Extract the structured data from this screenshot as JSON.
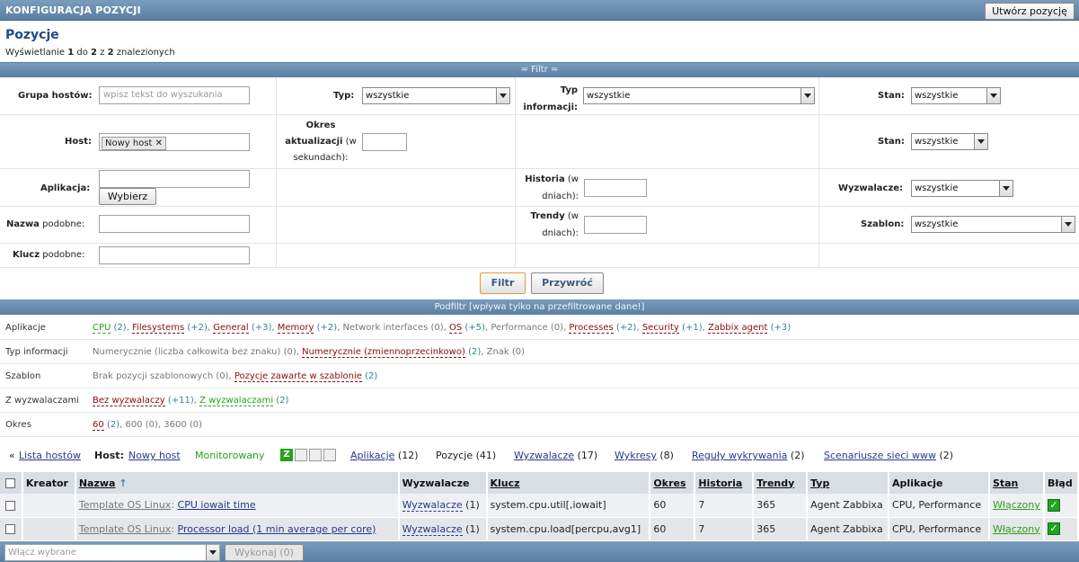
{
  "header": {
    "title": "KONFIGURACJA POZYCJI",
    "create_button": "Utwórz pozycję"
  },
  "page": {
    "heading": "Pozycje",
    "summary_prefix": "Wyświetlanie",
    "summary_from": "1",
    "summary_do": "do",
    "summary_to": "2",
    "summary_z": "z",
    "summary_total": "2",
    "summary_suffix": "znalezionych"
  },
  "filter": {
    "bar_label": "≈ Filtr ≈",
    "host_group_label": "Grupa hostów:",
    "host_group_placeholder": "wpisz tekst do wyszukania",
    "type_label": "Typ:",
    "type_value": "wszystkie",
    "info_type_label": "Typ informacji:",
    "info_type_value": "wszystkie",
    "state_label": "Stan:",
    "state_value": "wszystkie",
    "host_label": "Host:",
    "host_tag": "Nowy host",
    "interval_label_bold": "Okres aktualizacji",
    "interval_label_rest": "(w sekundach):",
    "state2_label": "Stan:",
    "state2_value": "wszystkie",
    "app_label": "Aplikacja:",
    "app_button": "Wybierz",
    "history_label_bold": "Historia",
    "history_label_rest": "(w dniach):",
    "triggers_label": "Wyzwalacze:",
    "triggers_value": "wszystkie",
    "name_label_bold": "Nazwa",
    "name_label_rest": "podobne:",
    "trends_label_bold": "Trendy",
    "trends_label_rest": "(w dniach):",
    "template_label": "Szablon:",
    "template_value": "wszystkie",
    "key_label_bold": "Klucz",
    "key_label_rest": "podobne:",
    "filter_button": "Filtr",
    "reset_button": "Przywróć"
  },
  "subfilter": {
    "bar_label": "Podfiltr [wpływa tylko na przefiltrowane dane!]",
    "apps_label": "Aplikacje",
    "apps": [
      {
        "name": "CPU",
        "count": "(2)",
        "style": "green"
      },
      {
        "name": "Filesystems",
        "count": "(+2)",
        "style": "red"
      },
      {
        "name": "General",
        "count": "(+3)",
        "style": "red"
      },
      {
        "name": "Memory",
        "count": "(+2)",
        "style": "red"
      },
      {
        "name": "Network interfaces",
        "count": "(0)",
        "style": "gray"
      },
      {
        "name": "OS",
        "count": "(+5)",
        "style": "red"
      },
      {
        "name": "Performance",
        "count": "(0)",
        "style": "gray"
      },
      {
        "name": "Processes",
        "count": "(+2)",
        "style": "red"
      },
      {
        "name": "Security",
        "count": "(+1)",
        "style": "red"
      },
      {
        "name": "Zabbix agent",
        "count": "(+3)",
        "style": "red"
      }
    ],
    "info_label": "Typ informacji",
    "info": [
      {
        "name": "Numerycznie (liczba całkowita bez znaku)",
        "count": "(0)",
        "style": "gray"
      },
      {
        "name": "Numerycznie (zmiennoprzecinkowo)",
        "count": "(2)",
        "style": "red"
      },
      {
        "name": "Znak",
        "count": "(0)",
        "style": "gray"
      }
    ],
    "template_label": "Szablon",
    "template": [
      {
        "name": "Brak pozycji szablonowych",
        "count": "(0)",
        "style": "gray"
      },
      {
        "name": "Pozycje zawarte w szablonie",
        "count": "(2)",
        "style": "red"
      }
    ],
    "triggers_label": "Z wyzwalaczami",
    "triggers": [
      {
        "name": "Bez wyzwalaczy",
        "count": "(+11)",
        "style": "red"
      },
      {
        "name": "Z wyzwalaczami",
        "count": "(2)",
        "style": "green"
      }
    ],
    "interval_label": "Okres",
    "interval": [
      {
        "name": "60",
        "count": "(2)",
        "style": "red"
      },
      {
        "name": "600",
        "count": "(0)",
        "style": "gray"
      },
      {
        "name": "3600",
        "count": "(0)",
        "style": "gray"
      }
    ]
  },
  "nav": {
    "back": "« ",
    "host_list": "Lista hostów",
    "host_label": "Host:",
    "host_name": "Nowy host",
    "monitored": "Monitorowany",
    "apps": "Aplikacje",
    "apps_count": "(12)",
    "items": "Pozycje",
    "items_count": "(41)",
    "triggers": "Wyzwalacze",
    "triggers_count": "(17)",
    "graphs": "Wykresy",
    "graphs_count": "(8)",
    "discovery": "Reguły wykrywania",
    "discovery_count": "(2)",
    "web": "Scenariusze sieci www",
    "web_count": "(2)",
    "z_icon": "Z"
  },
  "table": {
    "headers": {
      "creator": "Kreator",
      "name": "Nazwa",
      "triggers": "Wyzwalacze",
      "key": "Klucz",
      "interval": "Okres",
      "history": "Historia",
      "trends": "Trendy",
      "type": "Typ",
      "apps": "Aplikacje",
      "status": "Stan",
      "error": "Błąd"
    },
    "rows": [
      {
        "template": "Template OS Linux",
        "sep": ":",
        "name": "CPU iowait time",
        "triggers": "Wyzwalacze",
        "triggers_count": "(1)",
        "key": "system.cpu.util[,iowait]",
        "interval": "60",
        "history": "7",
        "trends": "365",
        "type": "Agent Zabbixa",
        "apps": "CPU, Performance",
        "status": "Włączony"
      },
      {
        "template": "Template OS Linux",
        "sep": ":",
        "name": "Processor load (1 min average per core)",
        "triggers": "Wyzwalacze",
        "triggers_count": "(1)",
        "key": "system.cpu.load[percpu,avg1]",
        "interval": "60",
        "history": "7",
        "trends": "365",
        "type": "Agent Zabbixa",
        "apps": "CPU, Performance",
        "status": "Włączony"
      }
    ]
  },
  "bottom": {
    "action_placeholder": "Włącz wybrane",
    "execute_button": "Wykonaj (0)"
  },
  "colors": {
    "header_bar": "#5a7fa3",
    "link_red": "#8a0d0d",
    "link_green": "#27a21b",
    "count": "#2a8a8a"
  }
}
